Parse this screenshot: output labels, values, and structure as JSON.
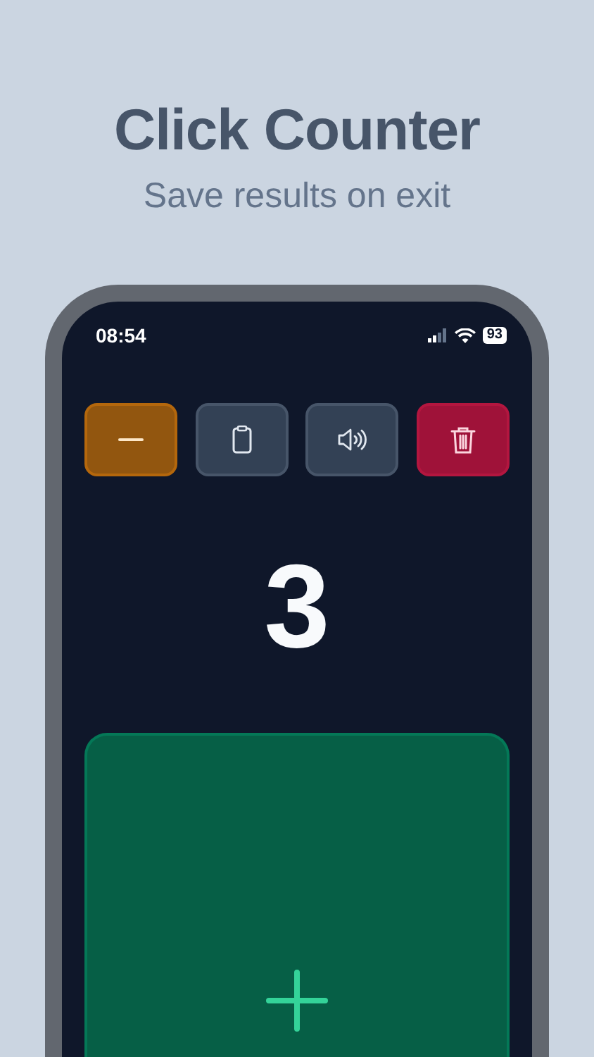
{
  "title": "Click Counter",
  "subtitle": "Save results on exit",
  "status_bar": {
    "time": "08:54",
    "battery": "93"
  },
  "buttons": [
    {
      "kind": "minus"
    },
    {
      "kind": "clipboard"
    },
    {
      "kind": "sound"
    },
    {
      "kind": "delete"
    }
  ],
  "counter": "3",
  "increment_pad": {
    "kind": "plus"
  }
}
